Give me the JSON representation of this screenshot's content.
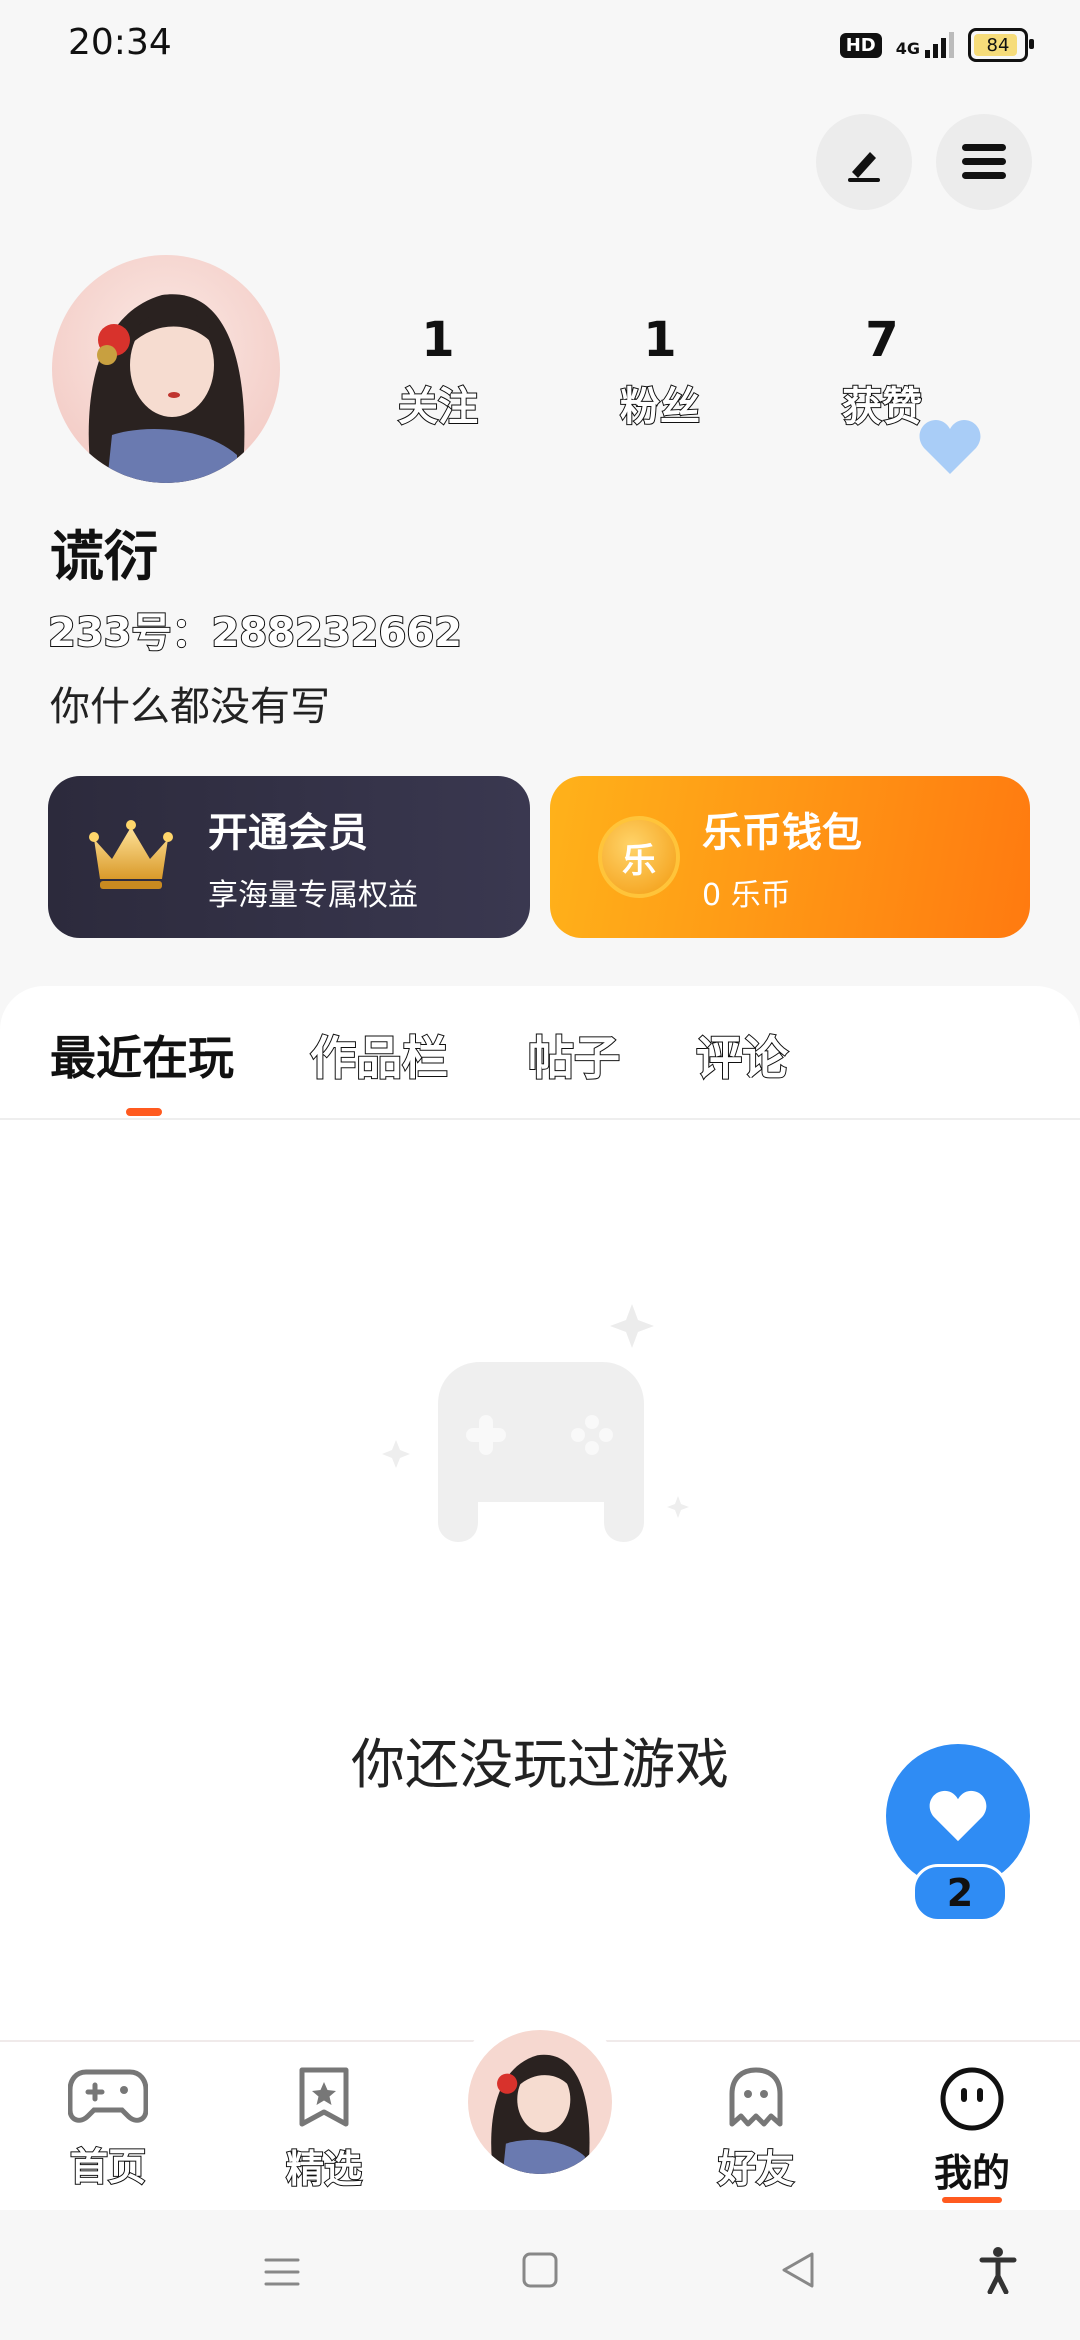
{
  "status_bar": {
    "time": "20:34",
    "hd": "HD",
    "network": "4G",
    "battery": "84",
    "battery_level": 0.84
  },
  "header": {
    "edit_icon": "pen-icon",
    "menu_icon": "menu-icon"
  },
  "profile": {
    "stats": [
      {
        "value": "1",
        "label": "关注"
      },
      {
        "value": "1",
        "label": "粉丝"
      },
      {
        "value": "7",
        "label": "获赞"
      }
    ],
    "name": "谎衍",
    "id_line": "233号：288232662",
    "bio": "你什么都没有写"
  },
  "cards": {
    "vip": {
      "title": "开通会员",
      "subtitle": "享海量专属权益"
    },
    "wallet": {
      "title": "乐币钱包",
      "subtitle": "0 乐币",
      "coin_glyph": "乐"
    }
  },
  "tabs": [
    "最近在玩",
    "作品栏",
    "帖子",
    "评论"
  ],
  "empty_state": {
    "text": "你还没玩过游戏"
  },
  "fab": {
    "count": "2"
  },
  "bottom_nav": {
    "items": [
      {
        "label": "首页"
      },
      {
        "label": "精选"
      },
      {
        "label": "好友"
      },
      {
        "label": "我的"
      }
    ]
  },
  "colors": {
    "accent": "#ff5a1f",
    "blue": "#2f8cf4",
    "vip_bg": "#2c2a3c",
    "wallet_bg": "#ff9a14"
  }
}
